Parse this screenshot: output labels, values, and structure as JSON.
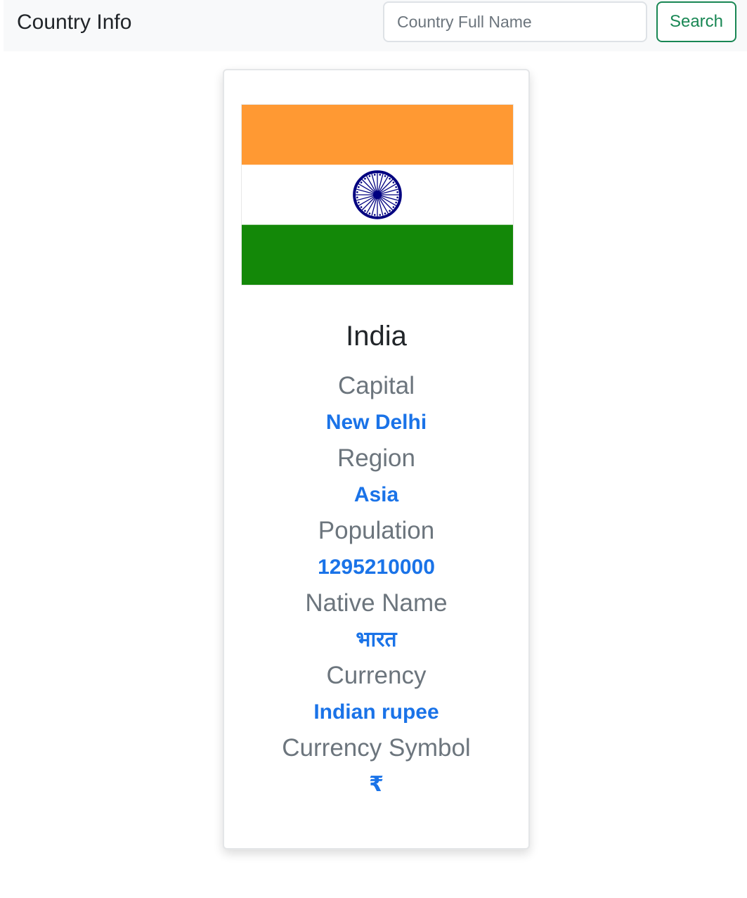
{
  "navbar": {
    "brand": "Country Info",
    "search_placeholder": "Country Full Name",
    "search_label": "Search"
  },
  "country": {
    "name": "India",
    "flag_icon": "india-flag-icon",
    "fields": [
      {
        "label": "Capital",
        "value": "New Delhi"
      },
      {
        "label": "Region",
        "value": "Asia"
      },
      {
        "label": "Population",
        "value": "1295210000"
      },
      {
        "label": "Native Name",
        "value": "भारत"
      },
      {
        "label": "Currency",
        "value": "Indian rupee"
      },
      {
        "label": "Currency Symbol",
        "value": "₹"
      }
    ]
  },
  "colors": {
    "label_gray": "#6c757d",
    "value_blue": "#1a73e8",
    "button_green": "#198754",
    "flag_saffron": "#ff9933",
    "flag_white": "#ffffff",
    "flag_green": "#138808",
    "flag_navy": "#000080"
  }
}
